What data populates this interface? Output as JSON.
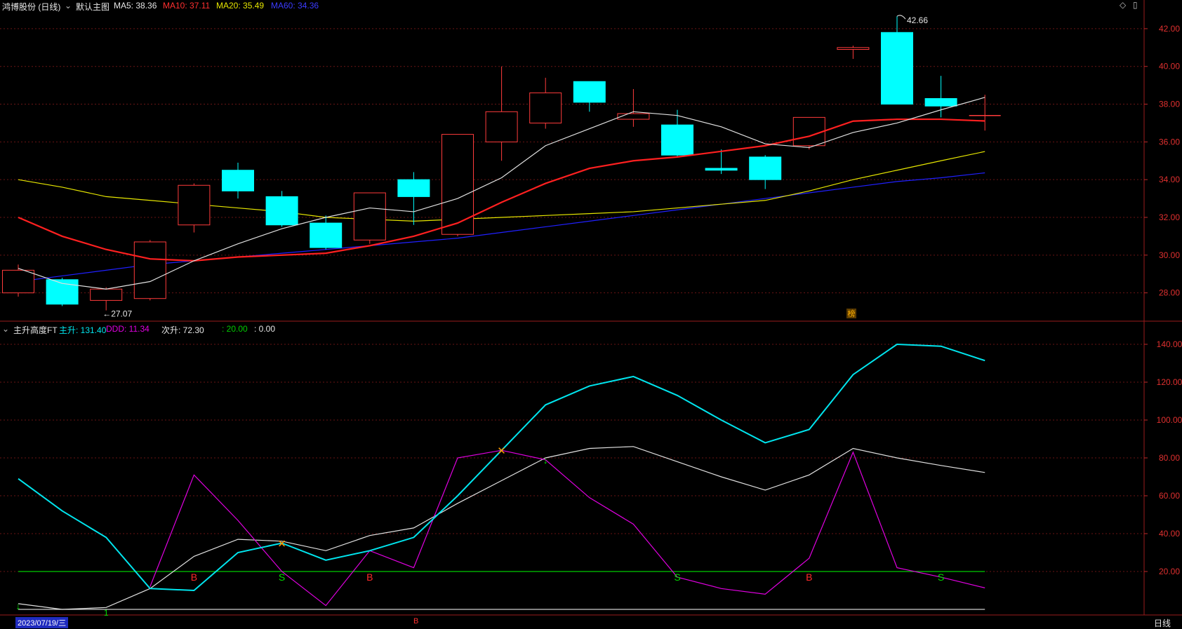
{
  "header": {
    "title": "鸿博股份 (日线)",
    "menu_label": "默认主图",
    "ma5": "MA5: 38.36",
    "ma10": "MA10: 37.11",
    "ma20": "MA20: 35.49",
    "ma60": "MA60: 34.36"
  },
  "sub_header": {
    "name": "主升高度FT",
    "zs": "主升: 131.40",
    "ddd": "DDD: 11.34",
    "cs": "次升: 72.30",
    "c4": ": 20.00",
    "c5": ": 0.00"
  },
  "footer": {
    "date": "2023/07/19/三",
    "b_marker": "B",
    "period": "日线"
  },
  "top_right_icons": [
    "diamond-icon",
    "book-icon"
  ],
  "colors": {
    "up": "#ff3b3b",
    "down": "#00ffff",
    "ma5": "#e0e0e0",
    "ma10": "#ff2020",
    "ma20": "#e6e600",
    "ma60": "#2020ff",
    "axis": "#e0302f",
    "zs": "#00e5ee",
    "ddd": "#e000e0",
    "cs": "#e0e0e0",
    "ref20": "#00cc00"
  },
  "chart_data": [
    {
      "type": "candlestick",
      "ylim": [
        26.5,
        43.0
      ],
      "yticks": [
        28,
        30,
        32,
        34,
        36,
        38,
        40,
        42
      ],
      "ytick_labels": [
        "28.00",
        "30.00",
        "32.00",
        "34.00",
        "36.00",
        "38.00",
        "40.00",
        "42.00"
      ],
      "candles": [
        {
          "o": 28.0,
          "h": 29.5,
          "l": 27.8,
          "c": 29.2
        },
        {
          "o": 28.7,
          "h": 28.8,
          "l": 27.3,
          "c": 27.4
        },
        {
          "o": 27.6,
          "h": 28.3,
          "l": 27.07,
          "c": 28.2
        },
        {
          "o": 27.7,
          "h": 30.8,
          "l": 27.6,
          "c": 30.7
        },
        {
          "o": 31.6,
          "h": 33.8,
          "l": 31.2,
          "c": 33.7
        },
        {
          "o": 34.5,
          "h": 34.9,
          "l": 33.0,
          "c": 33.4
        },
        {
          "o": 33.1,
          "h": 33.4,
          "l": 31.5,
          "c": 31.6
        },
        {
          "o": 31.7,
          "h": 32.1,
          "l": 30.3,
          "c": 30.4
        },
        {
          "o": 30.8,
          "h": 33.3,
          "l": 30.6,
          "c": 33.3
        },
        {
          "o": 34.0,
          "h": 34.4,
          "l": 31.6,
          "c": 33.1
        },
        {
          "o": 31.1,
          "h": 36.4,
          "l": 31.0,
          "c": 36.4
        },
        {
          "o": 36.0,
          "h": 40.0,
          "l": 35.0,
          "c": 37.6
        },
        {
          "o": 37.0,
          "h": 39.4,
          "l": 36.7,
          "c": 38.6
        },
        {
          "o": 39.2,
          "h": 39.2,
          "l": 37.6,
          "c": 38.1
        },
        {
          "o": 37.2,
          "h": 38.8,
          "l": 36.8,
          "c": 37.5
        },
        {
          "o": 36.9,
          "h": 37.7,
          "l": 35.2,
          "c": 35.3
        },
        {
          "o": 34.6,
          "h": 35.6,
          "l": 34.3,
          "c": 34.5
        },
        {
          "o": 35.2,
          "h": 35.3,
          "l": 33.5,
          "c": 34.0
        },
        {
          "o": 35.8,
          "h": 37.3,
          "l": 35.6,
          "c": 37.3
        },
        {
          "o": 40.9,
          "h": 41.1,
          "l": 40.4,
          "c": 41.0
        },
        {
          "o": 41.8,
          "h": 42.66,
          "l": 38.0,
          "c": 38.0
        },
        {
          "o": 38.3,
          "h": 39.5,
          "l": 37.3,
          "c": 37.9
        },
        {
          "o": 37.4,
          "h": 38.5,
          "l": 36.6,
          "c": 37.4
        }
      ],
      "ma5": [
        29.3,
        28.5,
        28.2,
        28.6,
        29.7,
        30.6,
        31.4,
        32.0,
        32.5,
        32.3,
        33.0,
        34.1,
        35.8,
        36.7,
        37.6,
        37.4,
        36.8,
        35.9,
        35.7,
        36.5,
        37.0,
        37.7,
        38.36
      ],
      "ma10": [
        32.0,
        31.0,
        30.3,
        29.8,
        29.7,
        29.9,
        30.0,
        30.1,
        30.5,
        31.0,
        31.7,
        32.8,
        33.8,
        34.6,
        35.0,
        35.2,
        35.5,
        35.8,
        36.3,
        37.1,
        37.2,
        37.2,
        37.11
      ],
      "ma20": [
        34.0,
        33.6,
        33.1,
        32.9,
        32.7,
        32.5,
        32.3,
        32.0,
        31.9,
        31.8,
        31.9,
        32.0,
        32.1,
        32.2,
        32.3,
        32.5,
        32.7,
        32.9,
        33.4,
        34.0,
        34.5,
        35.0,
        35.49
      ],
      "ma60": [
        28.6,
        28.9,
        29.2,
        29.5,
        29.7,
        29.9,
        30.1,
        30.3,
        30.5,
        30.7,
        30.9,
        31.2,
        31.5,
        31.8,
        32.1,
        32.4,
        32.7,
        33.0,
        33.3,
        33.6,
        33.9,
        34.1,
        34.36
      ],
      "annotations": [
        {
          "candle": 2,
          "text": "←27.07"
        },
        {
          "candle": 20,
          "text": "42.66"
        }
      ],
      "badge": "榜"
    },
    {
      "type": "line",
      "ylim": [
        0,
        150
      ],
      "yticks": [
        20,
        40,
        60,
        80,
        100,
        120,
        140
      ],
      "ytick_labels": [
        "20.00",
        "40.00",
        "60.00",
        "80.00",
        "100.00",
        "120.00",
        "140.00"
      ],
      "series": [
        {
          "name": "主升",
          "values": [
            69,
            52,
            38,
            11,
            10,
            30,
            35,
            26,
            31,
            38,
            60,
            84,
            108,
            118,
            123,
            113,
            100,
            88,
            95,
            124,
            140,
            139,
            131.4
          ]
        },
        {
          "name": "DDD",
          "values": [
            null,
            null,
            null,
            12,
            71,
            47,
            20,
            2,
            31,
            22,
            80,
            84,
            79,
            59,
            45,
            17,
            11,
            8,
            27,
            83,
            22,
            17,
            11.34
          ]
        },
        {
          "name": "次升",
          "values": [
            3,
            0,
            1,
            11,
            28,
            37,
            36,
            31,
            39,
            43,
            56,
            68,
            80,
            85,
            86,
            78,
            70,
            63,
            71,
            85,
            80,
            76,
            72.3
          ]
        },
        {
          "values": [
            20,
            20,
            20,
            20,
            20,
            20,
            20,
            20,
            20,
            20,
            20,
            20,
            20,
            20,
            20,
            20,
            20,
            20,
            20,
            20,
            20,
            20,
            20
          ]
        },
        {
          "values": [
            0,
            0,
            0,
            0,
            0,
            0,
            0,
            0,
            0,
            0,
            0,
            0,
            0,
            0,
            0,
            0,
            0,
            0,
            0,
            0,
            0,
            0,
            0
          ]
        }
      ],
      "signals": [
        {
          "candle": 0,
          "text": "↓",
          "kind": "down-arrow"
        },
        {
          "candle": 2,
          "text": "1",
          "kind": "one"
        },
        {
          "candle": 4,
          "text": "B",
          "kind": "buy"
        },
        {
          "candle": 6,
          "text": "S",
          "kind": "sell"
        },
        {
          "candle": 6,
          "text": "✕",
          "kind": "cross"
        },
        {
          "candle": 8,
          "text": "B",
          "kind": "buy"
        },
        {
          "candle": 11,
          "text": "✕",
          "kind": "cross"
        },
        {
          "candle": 12,
          "text": "↓",
          "kind": "down-arrow"
        },
        {
          "candle": 15,
          "text": "S",
          "kind": "sell"
        },
        {
          "candle": 18,
          "text": "B",
          "kind": "buy"
        },
        {
          "candle": 21,
          "text": "S",
          "kind": "sell"
        }
      ]
    }
  ]
}
